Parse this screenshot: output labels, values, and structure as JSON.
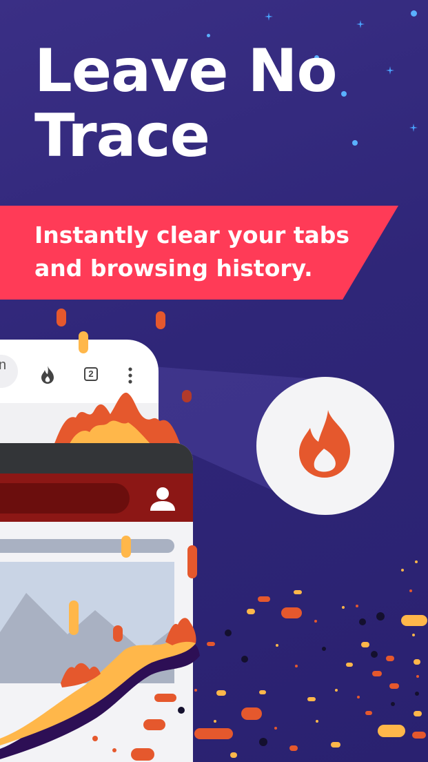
{
  "headline": {
    "line1": "Leave No",
    "line2": "Trace"
  },
  "banner": {
    "line1": "Instantly clear your tabs",
    "line2": "and browsing history."
  },
  "browser_toolbar": {
    "url_fragment": "n",
    "fire_icon": "fire-icon",
    "tab_count": "2",
    "menu_icon": "kebab-menu-icon"
  },
  "card": {
    "profile_icon": "user-icon"
  },
  "feature_icon": "fire-icon",
  "colors": {
    "background": "#2f2678",
    "banner": "#ff3b57",
    "fire_orange": "#e5582d",
    "fire_yellow": "#ffb74a",
    "card_red": "#8c1715",
    "card_dark": "#333538"
  }
}
